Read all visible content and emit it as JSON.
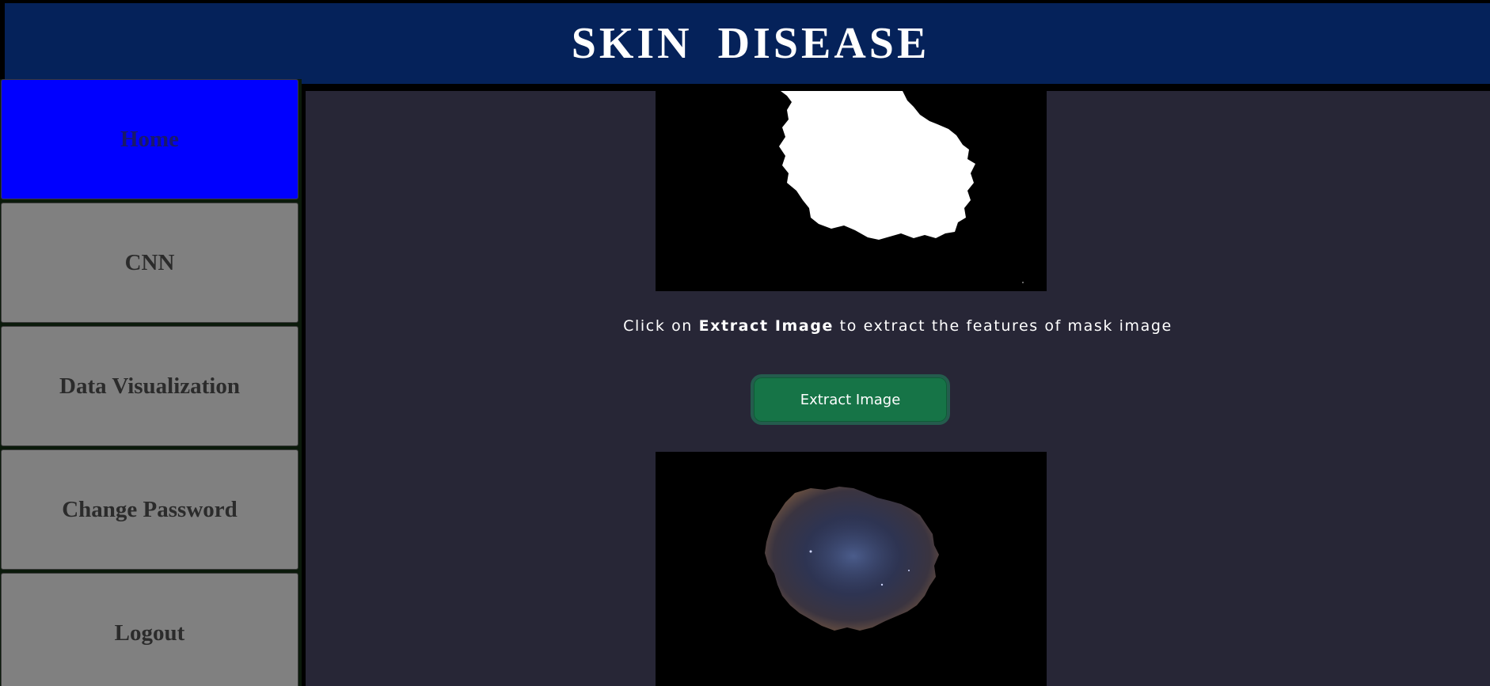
{
  "header": {
    "title": "SKIN DISEASE"
  },
  "sidebar": {
    "items": [
      {
        "label": "Home",
        "active": true
      },
      {
        "label": "CNN",
        "active": false
      },
      {
        "label": "Data Visualization",
        "active": false
      },
      {
        "label": "Change Password",
        "active": false
      },
      {
        "label": "Logout",
        "active": false
      }
    ]
  },
  "main": {
    "instruction": {
      "prefix": "Click on ",
      "emphasis": "Extract Image",
      "suffix": " to extract the features of mask image"
    },
    "extract_button_label": "Extract Image",
    "images": {
      "mask": "mask-image",
      "extracted": "extracted-lesion-image"
    }
  },
  "colors": {
    "header_bg": "#05225a",
    "nav_active": "#0000ff",
    "nav_default": "#808080",
    "content_bg": "#272636",
    "button_bg": "#167447"
  }
}
